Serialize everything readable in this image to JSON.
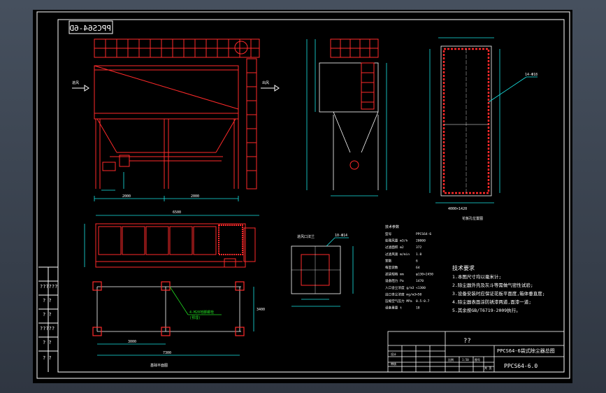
{
  "drawing": {
    "title_mirrored": "PPCS64-6D",
    "arrow_in_label": "进风",
    "arrow_out_label": "出风",
    "plan_caption": "基础平面图",
    "outline_caption": "花板孔位置图",
    "flange_caption": "进风口法兰",
    "leader_note_1": "4-M20地脚螺栓",
    "leader_note_2": "(预埋)",
    "dim_front_left": "2000",
    "dim_front_right": "2000",
    "dim_front_total": "6500",
    "dim_plan_1": "3000",
    "dim_plan_2": "7300",
    "dim_plan_h": "3400",
    "dim_flange_top": "10-Φ14",
    "dim_outline_top": "14-Φ18",
    "dim_outline_bottom": "4000×1420"
  },
  "colors": {
    "frame": "#ffffff",
    "linework": "#ff2a2a",
    "dimension": "#19e6e6",
    "text": "#ffffff",
    "leader": "#22dd22",
    "yellow": "#ffff33"
  },
  "tech_table": {
    "header": "技术参数",
    "rows": [
      {
        "label": "型号",
        "value": "PPCS64-6"
      },
      {
        "label": "处理风量 m3/h",
        "value": "20000"
      },
      {
        "label": "过滤面积 m2",
        "value": "372"
      },
      {
        "label": "过滤风速 m/min",
        "value": "1.0"
      },
      {
        "label": "室数",
        "value": "6"
      },
      {
        "label": "每室袋数",
        "value": "64"
      },
      {
        "label": "滤袋规格 mm",
        "value": "φ130×2450"
      },
      {
        "label": "设备阻力 Pa",
        "value": "1470"
      },
      {
        "label": "入口含尘浓度 g/m3",
        "value": "<1300"
      },
      {
        "label": "出口含尘浓度 mg/m3",
        "value": "<50"
      },
      {
        "label": "压缩空气压力 MPa",
        "value": "0.5-0.7"
      },
      {
        "label": "设备重量 t",
        "value": "18"
      }
    ]
  },
  "notes": {
    "title": "技术要求",
    "lines": [
      "1.本图尺寸均以毫米计;",
      "2.除尘器外壳及灰斗等需做气密性试验;",
      "3.设备安装时应保证花板平面度,箱体垂直度;",
      "4.除尘器表面涂防锈漆两道,面漆一道;",
      "5.其余按GB/T6719-2009执行。"
    ]
  },
  "title_block": {
    "drawing_name": "??",
    "project_line": "PPCS64-6袋式除尘器总图",
    "drawing_number": "PPCS64-6.0",
    "cells": [
      "设计",
      "审核",
      "比例",
      "1:50",
      "图号",
      "共 页"
    ]
  },
  "side_strip": {
    "labels": [
      "??????",
      "? ?",
      "? ?",
      "?????",
      "? ?",
      "? ?"
    ]
  }
}
